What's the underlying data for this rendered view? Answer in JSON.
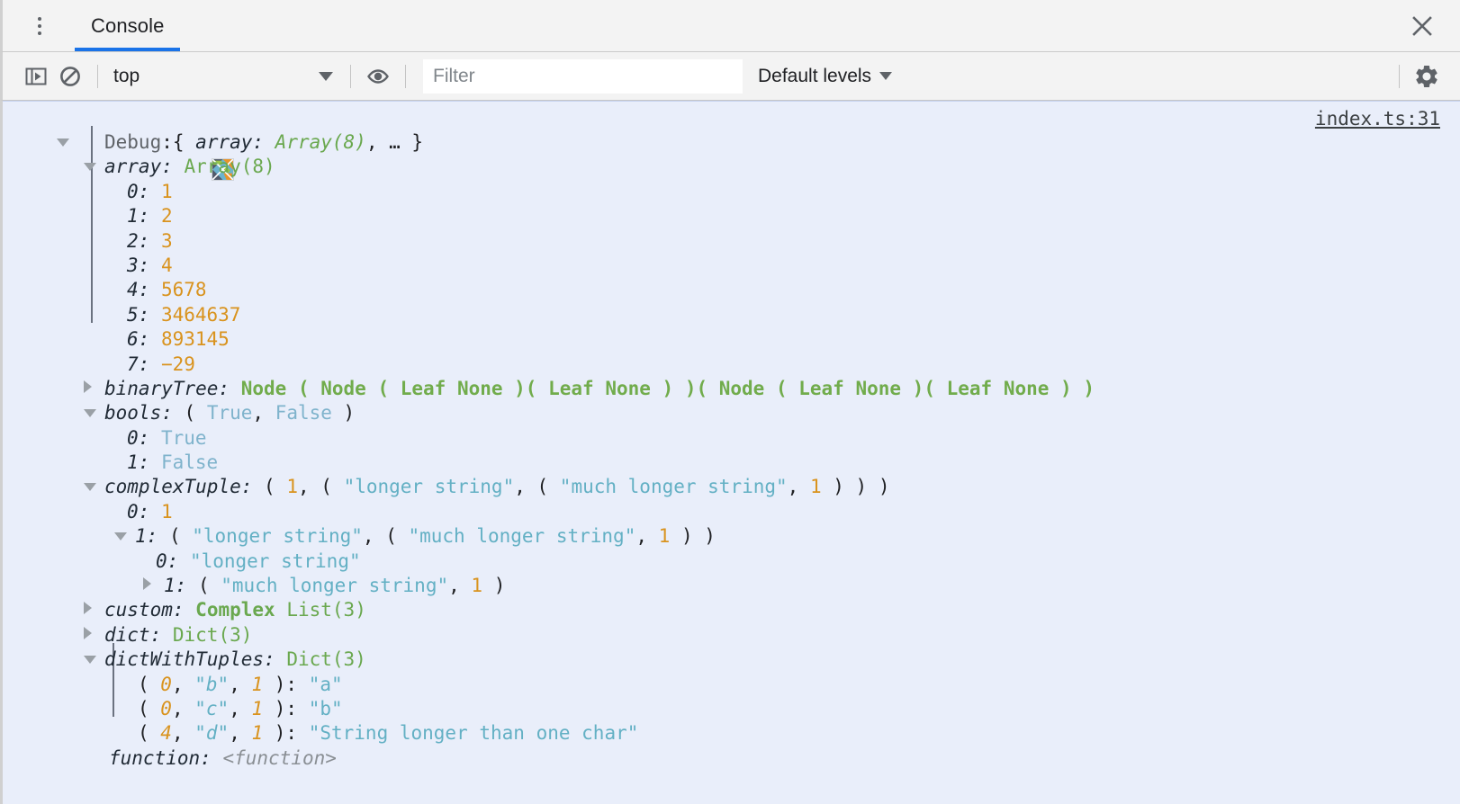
{
  "window": {
    "tab_label": "Console",
    "kebab_name": "more-tabs",
    "close_label": "×"
  },
  "toolbar": {
    "sidebar_toggle_name": "console-sidebar-toggle",
    "clear_name": "clear-console",
    "context_value": "top",
    "eye_name": "live-expression",
    "filter_placeholder": "Filter",
    "filter_value": "",
    "levels_label": "Default levels",
    "settings_name": "settings"
  },
  "console": {
    "source_link": "index.ts:31",
    "root": {
      "label": "Debug",
      "colon": ":",
      "preview_open": "{ ",
      "preview_key": "array:",
      "preview_type": " Array(8)",
      "preview_tail": ", … }"
    },
    "rows": [
      {
        "id": "array",
        "key": "array:",
        "type": " Array(8)"
      },
      {
        "id": "array-0",
        "idx": "0:",
        "num": "1"
      },
      {
        "id": "array-1",
        "idx": "1:",
        "num": "2"
      },
      {
        "id": "array-2",
        "idx": "2:",
        "num": "3"
      },
      {
        "id": "array-3",
        "idx": "3:",
        "num": "4"
      },
      {
        "id": "array-4",
        "idx": "4:",
        "num": "5678"
      },
      {
        "id": "array-5",
        "idx": "5:",
        "num": "3464637"
      },
      {
        "id": "array-6",
        "idx": "6:",
        "num": "893145"
      },
      {
        "id": "array-7",
        "idx": "7:",
        "num": "−29"
      },
      {
        "id": "binaryTree",
        "key": "binaryTree:",
        "value": "Node ( Node ( Leaf None )( Leaf None ) )( Node ( Leaf None )( Leaf None ) )"
      },
      {
        "id": "bools",
        "key": "bools:"
      },
      {
        "id": "bools-0",
        "idx": "0:",
        "bool": "True"
      },
      {
        "id": "bools-1",
        "idx": "1:",
        "bool": "False"
      },
      {
        "id": "complexTuple",
        "key": "complexTuple:"
      },
      {
        "id": "ct-0",
        "idx": "0:",
        "num": "1"
      },
      {
        "id": "ct-1",
        "idx": "1:"
      },
      {
        "id": "ct-1-0",
        "idx": "0:",
        "str": "\"longer string\""
      },
      {
        "id": "ct-1-1",
        "idx": "1:"
      },
      {
        "id": "custom",
        "key": "custom:",
        "bold": "Complex",
        "type": " List(3)"
      },
      {
        "id": "dict",
        "key": "dict:",
        "type": "Dict(3)"
      },
      {
        "id": "dictWithTuples",
        "key": "dictWithTuples:",
        "type": "Dict(3)"
      },
      {
        "id": "dwt-0"
      },
      {
        "id": "dwt-1"
      },
      {
        "id": "dwt-2"
      },
      {
        "id": "function",
        "key": "function:",
        "fn": "<function>"
      }
    ],
    "literals": {
      "bools_preview": "( True, False )",
      "bools_true": "True",
      "bools_false": "False",
      "ct_preview": "( 1, ( \"longer string\", ( \"much longer string\", 1 ) ) )",
      "ct_1_preview": "( \"longer string\", ( \"much longer string\", 1 ) )",
      "ct_1_1_preview": "( \"much longer string\", 1 )",
      "str_longer": "\"longer string\"",
      "str_much_longer": "\"much longer string\"",
      "one": "1",
      "dwt_k0_num0": "0",
      "dwt_k0_str": "\"b\"",
      "dwt_k0_num1": "1",
      "dwt_v0": "\"a\"",
      "dwt_k1_num0": "0",
      "dwt_k1_str": "\"c\"",
      "dwt_k1_num1": "1",
      "dwt_v1": "\"b\"",
      "dwt_k2_num0": "4",
      "dwt_k2_str": "\"d\"",
      "dwt_k2_num1": "1",
      "dwt_v2": "\"String longer than one char\"",
      "fn_value": "<function>",
      "custom_bold": "Complex",
      "custom_type": "List(3)",
      "dict_type": "Dict(3)",
      "dwt_type": "Dict(3)",
      "paren_open": "( ",
      "paren_close": " )",
      "comma": ", ",
      "colon_sp": ": ",
      "key_close": " ): "
    }
  },
  "colors": {
    "accent": "#1a73e8",
    "entry_bg": "#e9eefa",
    "entry_border": "#c6d3f0",
    "number": "#d9931e",
    "string": "#63b0c4",
    "type": "#6aa84f",
    "label": "#5f6368"
  }
}
